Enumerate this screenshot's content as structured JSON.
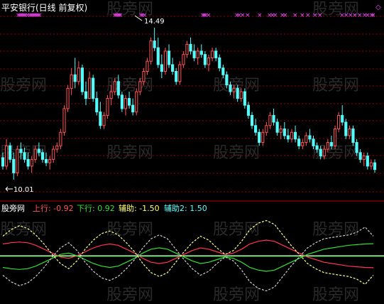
{
  "colors": {
    "background": "#000000",
    "up_candle": "#ff5555",
    "down_candle": "#54fcfc",
    "grid": "#8b0000",
    "panel_border": "#aa0000",
    "signal_x": "#ff44ff",
    "up_line": "#ff3355",
    "down_line": "#33dd33",
    "aux1": "#ffff88",
    "aux2": "#cccccc",
    "text": "#ffffff",
    "label_up": "#ff5555",
    "label_down": "#33dd33",
    "label_aux1": "#ffff66",
    "label_aux2": "#55ffff"
  },
  "price_panel": {
    "title": "平安银行(日线 前复权)",
    "high_marker": "14.49",
    "low_marker": "10.01",
    "diamond_icon": "◇"
  },
  "indicator_panel": {
    "name": "股旁网",
    "up_label": "上行: -0.92",
    "down_label": "下行: 0.92",
    "aux1_label": "辅助: -1.50",
    "aux2_label": "辅助2: 1.50"
  },
  "watermark_text": "股旁网",
  "chart_data": [
    {
      "type": "candlestick",
      "title": "平安银行(日线 前复权)",
      "ylim": [
        9.6,
        15.1
      ],
      "ohlc": [
        [
          10.65,
          10.8,
          10.3,
          10.4
        ],
        [
          10.4,
          11.2,
          10.3,
          11.0
        ],
        [
          11.0,
          11.1,
          10.5,
          10.6
        ],
        [
          10.6,
          10.8,
          10.0,
          10.2
        ],
        [
          10.2,
          11.0,
          10.1,
          10.9
        ],
        [
          10.9,
          11.1,
          10.6,
          10.8
        ],
        [
          10.8,
          10.95,
          10.5,
          10.6
        ],
        [
          10.6,
          10.8,
          10.3,
          10.4
        ],
        [
          10.4,
          10.7,
          10.2,
          10.6
        ],
        [
          10.6,
          11.0,
          10.5,
          10.9
        ],
        [
          10.9,
          11.1,
          10.7,
          10.8
        ],
        [
          10.8,
          10.9,
          10.5,
          10.6
        ],
        [
          10.6,
          10.8,
          10.4,
          10.5
        ],
        [
          10.5,
          10.7,
          10.3,
          10.6
        ],
        [
          10.6,
          11.0,
          10.5,
          10.9
        ],
        [
          10.9,
          11.1,
          10.8,
          11.0
        ],
        [
          11.0,
          11.5,
          10.9,
          11.4
        ],
        [
          11.4,
          12.2,
          11.3,
          12.1
        ],
        [
          12.1,
          12.8,
          12.0,
          12.7
        ],
        [
          12.7,
          13.3,
          12.5,
          13.1
        ],
        [
          13.1,
          13.6,
          12.7,
          12.9
        ],
        [
          12.9,
          13.5,
          12.8,
          13.3
        ],
        [
          13.3,
          13.4,
          12.5,
          12.6
        ],
        [
          12.6,
          12.9,
          12.2,
          12.4
        ],
        [
          12.4,
          13.2,
          12.4,
          13.0
        ],
        [
          13.0,
          13.1,
          12.3,
          12.4
        ],
        [
          12.4,
          12.6,
          11.9,
          12.0
        ],
        [
          12.0,
          12.3,
          11.5,
          11.6
        ],
        [
          11.6,
          12.0,
          11.5,
          11.9
        ],
        [
          11.9,
          12.5,
          11.8,
          12.4
        ],
        [
          12.4,
          12.8,
          12.2,
          12.6
        ],
        [
          12.6,
          13.0,
          12.5,
          12.9
        ],
        [
          12.9,
          13.1,
          12.4,
          12.5
        ],
        [
          12.5,
          12.6,
          12.0,
          12.1
        ],
        [
          12.1,
          12.5,
          11.9,
          12.4
        ],
        [
          12.4,
          12.6,
          12.1,
          12.2
        ],
        [
          12.2,
          12.4,
          11.9,
          12.0
        ],
        [
          12.0,
          12.7,
          11.9,
          12.6
        ],
        [
          12.6,
          13.0,
          12.5,
          12.9
        ],
        [
          12.9,
          13.3,
          12.8,
          13.2
        ],
        [
          13.2,
          13.6,
          13.1,
          13.5
        ],
        [
          13.5,
          14.2,
          13.4,
          14.1
        ],
        [
          14.1,
          14.49,
          13.8,
          13.9
        ],
        [
          13.9,
          14.2,
          13.3,
          13.4
        ],
        [
          13.4,
          13.7,
          13.0,
          13.2
        ],
        [
          13.2,
          13.9,
          13.1,
          13.8
        ],
        [
          13.8,
          14.0,
          13.3,
          13.4
        ],
        [
          13.4,
          13.6,
          13.1,
          13.2
        ],
        [
          13.2,
          13.3,
          12.8,
          12.9
        ],
        [
          12.9,
          13.5,
          12.8,
          13.4
        ],
        [
          13.4,
          13.8,
          13.3,
          13.7
        ],
        [
          13.7,
          14.1,
          13.6,
          14.0
        ],
        [
          14.0,
          14.2,
          13.7,
          13.8
        ],
        [
          13.8,
          14.0,
          13.5,
          13.6
        ],
        [
          13.6,
          13.9,
          13.4,
          13.8
        ],
        [
          13.8,
          14.0,
          13.6,
          13.7
        ],
        [
          13.7,
          13.8,
          13.3,
          13.4
        ],
        [
          13.4,
          13.7,
          13.2,
          13.6
        ],
        [
          13.6,
          13.9,
          13.5,
          13.8
        ],
        [
          13.8,
          13.9,
          13.5,
          13.6
        ],
        [
          13.6,
          13.7,
          13.2,
          13.3
        ],
        [
          13.3,
          13.4,
          13.0,
          13.1
        ],
        [
          13.1,
          13.2,
          12.7,
          12.8
        ],
        [
          12.8,
          12.9,
          12.5,
          12.6
        ],
        [
          12.6,
          12.8,
          12.4,
          12.7
        ],
        [
          12.7,
          12.8,
          12.3,
          12.4
        ],
        [
          12.4,
          12.7,
          12.3,
          12.6
        ],
        [
          12.6,
          12.7,
          12.1,
          12.2
        ],
        [
          12.2,
          12.3,
          11.8,
          11.9
        ],
        [
          11.9,
          12.0,
          11.5,
          11.6
        ],
        [
          11.6,
          11.8,
          11.3,
          11.4
        ],
        [
          11.4,
          11.5,
          11.0,
          11.1
        ],
        [
          11.1,
          11.5,
          11.0,
          11.4
        ],
        [
          11.4,
          11.7,
          11.3,
          11.6
        ],
        [
          11.6,
          12.0,
          11.5,
          11.9
        ],
        [
          11.9,
          12.1,
          11.6,
          11.7
        ],
        [
          11.7,
          11.8,
          11.3,
          11.4
        ],
        [
          11.4,
          11.6,
          11.2,
          11.5
        ],
        [
          11.5,
          11.7,
          11.2,
          11.3
        ],
        [
          11.3,
          11.5,
          11.1,
          11.2
        ],
        [
          11.2,
          11.5,
          11.1,
          11.4
        ],
        [
          11.4,
          11.6,
          11.1,
          11.2
        ],
        [
          11.2,
          11.3,
          10.9,
          11.0
        ],
        [
          11.0,
          11.2,
          10.9,
          11.1
        ],
        [
          11.1,
          11.4,
          11.0,
          11.3
        ],
        [
          11.3,
          11.5,
          11.1,
          11.2
        ],
        [
          11.2,
          11.3,
          10.9,
          11.0
        ],
        [
          11.0,
          11.1,
          10.8,
          10.9
        ],
        [
          10.9,
          11.0,
          10.6,
          10.7
        ],
        [
          10.7,
          11.0,
          10.6,
          10.9
        ],
        [
          10.9,
          11.2,
          10.8,
          11.1
        ],
        [
          11.1,
          11.3,
          10.9,
          11.0
        ],
        [
          11.0,
          11.6,
          10.9,
          11.5
        ],
        [
          11.5,
          12.0,
          11.4,
          11.9
        ],
        [
          11.9,
          12.2,
          11.6,
          11.7
        ],
        [
          11.7,
          11.8,
          11.2,
          11.3
        ],
        [
          11.3,
          11.6,
          11.2,
          11.5
        ],
        [
          11.5,
          11.6,
          11.0,
          11.1
        ],
        [
          11.1,
          11.2,
          10.7,
          10.8
        ],
        [
          10.8,
          10.9,
          10.5,
          10.6
        ],
        [
          10.6,
          10.8,
          10.4,
          10.7
        ],
        [
          10.7,
          10.8,
          10.3,
          10.4
        ],
        [
          10.4,
          10.6,
          10.3,
          10.5
        ],
        [
          10.5,
          10.6,
          10.2,
          10.3
        ]
      ]
    },
    {
      "type": "line",
      "title": "股旁网",
      "ylim": [
        -3,
        3
      ],
      "series": [
        {
          "name": "上行",
          "values": [
            0.9,
            1.0,
            1.05,
            1.0,
            0.8,
            0.5,
            0.2,
            -0.1,
            -0.2,
            0.0,
            0.3,
            0.6,
            0.8,
            0.9,
            0.8,
            0.5,
            0.2,
            -0.2,
            -0.5,
            -0.6,
            -0.5,
            -0.2,
            0.1,
            0.4,
            0.6,
            0.5,
            0.3,
            0.1,
            0.2,
            0.5,
            0.9,
            1.1,
            1.2,
            1.1,
            0.8,
            0.5,
            0.2,
            -0.1,
            -0.3,
            -0.5,
            -0.6,
            -0.7,
            -0.8,
            -0.85,
            -0.9,
            -0.92
          ]
        },
        {
          "name": "下行",
          "values": [
            -0.9,
            -1.0,
            -1.05,
            -1.0,
            -0.8,
            -0.5,
            -0.2,
            0.1,
            0.2,
            0.0,
            -0.3,
            -0.6,
            -0.8,
            -0.9,
            -0.8,
            -0.5,
            -0.2,
            0.2,
            0.5,
            0.6,
            0.5,
            0.2,
            -0.1,
            -0.4,
            -0.6,
            -0.5,
            -0.3,
            -0.1,
            -0.2,
            -0.5,
            -0.9,
            -1.1,
            -1.2,
            -1.1,
            -0.8,
            -0.5,
            -0.2,
            0.1,
            0.3,
            0.5,
            0.6,
            0.7,
            0.8,
            0.85,
            0.9,
            0.92
          ]
        },
        {
          "name": "辅助",
          "values": [
            1.5,
            2.0,
            2.3,
            2.1,
            1.6,
            0.9,
            0.1,
            -0.6,
            -1.0,
            -0.4,
            0.5,
            1.2,
            1.7,
            1.9,
            1.6,
            1.0,
            0.3,
            -0.6,
            -1.3,
            -1.6,
            -1.3,
            -0.5,
            0.3,
            1.0,
            1.5,
            1.2,
            0.6,
            0.1,
            0.4,
            1.1,
            2.0,
            2.5,
            2.7,
            2.4,
            1.6,
            0.8,
            0.1,
            -0.6,
            -1.0,
            -1.3,
            -1.4,
            -1.5,
            -1.6,
            -1.8,
            -2.2,
            -1.5
          ]
        },
        {
          "name": "辅助2",
          "values": [
            -1.5,
            -2.0,
            -2.3,
            -2.1,
            -1.6,
            -0.9,
            -0.1,
            0.6,
            1.0,
            0.4,
            -0.5,
            -1.2,
            -1.7,
            -1.9,
            -1.6,
            -1.0,
            -0.3,
            0.6,
            1.3,
            1.6,
            1.3,
            0.5,
            -0.3,
            -1.0,
            -1.5,
            -1.2,
            -0.6,
            -0.1,
            -0.4,
            -1.1,
            -2.0,
            -2.5,
            -2.7,
            -2.4,
            -1.6,
            -0.8,
            -0.1,
            0.6,
            1.0,
            1.3,
            1.4,
            1.5,
            1.6,
            1.8,
            2.2,
            1.5
          ]
        }
      ]
    }
  ]
}
